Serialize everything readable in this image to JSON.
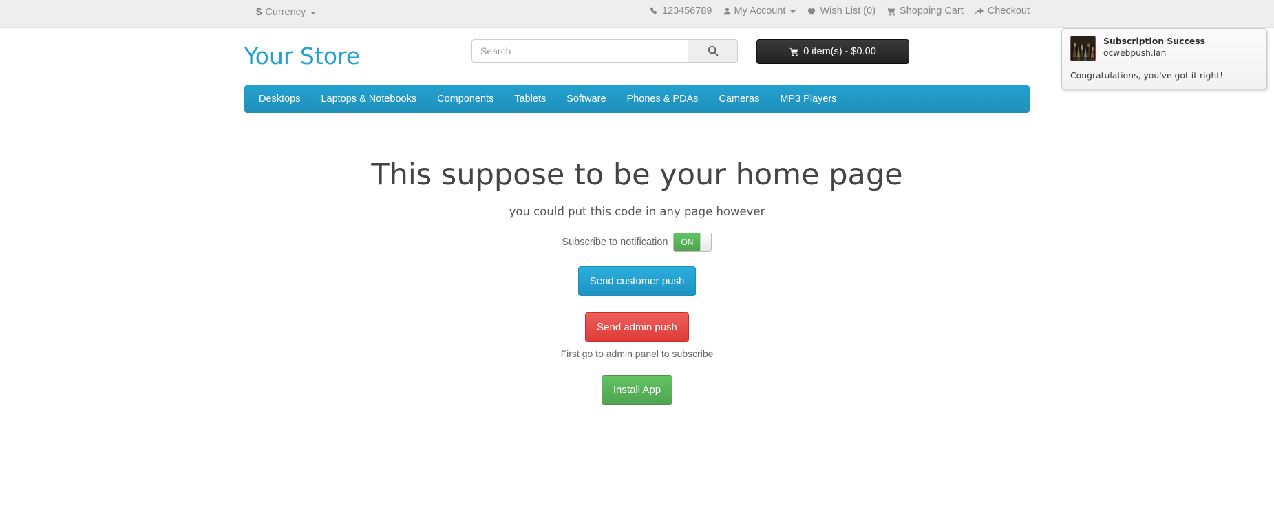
{
  "topbar": {
    "currency": {
      "label": "Currency",
      "symbol": "$",
      "icon": "dollar-icon"
    },
    "links": [
      {
        "label": "123456789",
        "icon": "phone-icon"
      },
      {
        "label": "My Account",
        "icon": "user-icon",
        "caret": true
      },
      {
        "label": "Wish List (0)",
        "icon": "heart-icon"
      },
      {
        "label": "Shopping Cart",
        "icon": "cart-icon"
      },
      {
        "label": "Checkout",
        "icon": "share-arrow-icon"
      }
    ]
  },
  "header": {
    "logo": "Your Store",
    "search": {
      "placeholder": "Search",
      "value": "",
      "button_icon": "search-icon"
    },
    "cart": {
      "label": "0 item(s) - $0.00",
      "icon": "cart-icon"
    }
  },
  "nav": {
    "items": [
      {
        "label": "Desktops"
      },
      {
        "label": "Laptops & Notebooks"
      },
      {
        "label": "Components"
      },
      {
        "label": "Tablets"
      },
      {
        "label": "Software"
      },
      {
        "label": "Phones & PDAs"
      },
      {
        "label": "Cameras"
      },
      {
        "label": "MP3 Players"
      }
    ]
  },
  "content": {
    "title": "This suppose to be your home page",
    "subtitle": "you could put this code in any page however",
    "subscribe": {
      "label": "Subscribe to notification",
      "toggle_state": "ON"
    },
    "customer_push_button": "Send customer push",
    "admin_push_button": "Send admin push",
    "admin_helper_text": "First go to admin panel to subscribe",
    "install_button": "Install App"
  },
  "notification": {
    "title": "Subscription Success",
    "origin": "ocwebpush.lan",
    "body": "Congratulations, you've got it right!",
    "thumbnail": "site-thumbnail-image"
  },
  "colors": {
    "brand_blue": "#23a1d1",
    "nav_blue": "#229ac8",
    "danger_red": "#e4443c",
    "success_green": "#5bb75b",
    "topbar_gray": "#eeeeee",
    "cart_black": "#292929"
  }
}
